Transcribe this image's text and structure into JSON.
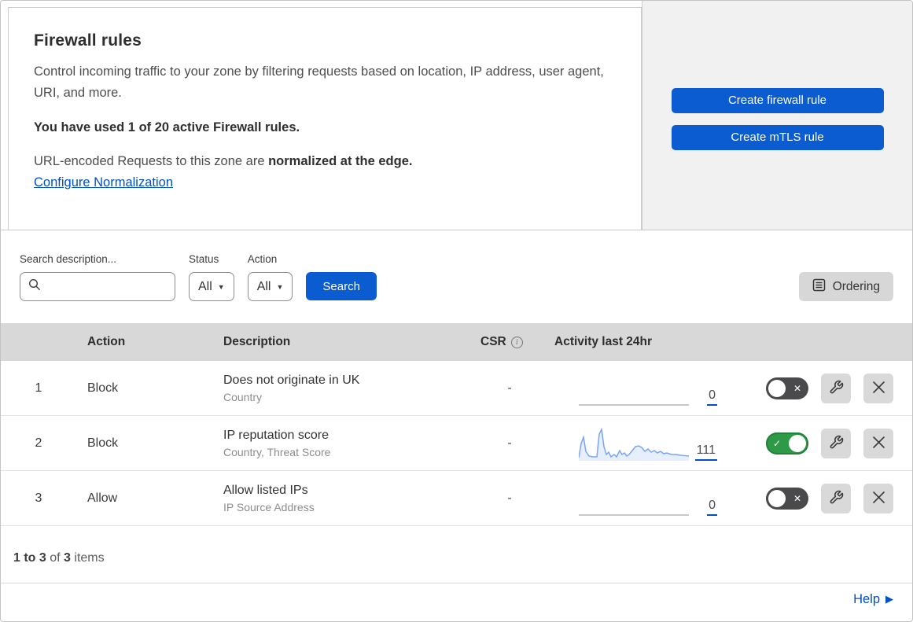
{
  "intro": {
    "title": "Firewall rules",
    "description": "Control incoming traffic to your zone by filtering requests based on location, IP address, user agent, URI, and more.",
    "usage": "You have used 1 of 20 active Firewall rules.",
    "normalization_prefix": "URL-encoded Requests to this zone are ",
    "normalization_bold": "normalized at the edge.",
    "normalization_link": "Configure Normalization"
  },
  "side_panel": {
    "create_firewall_label": "Create firewall rule",
    "create_mtls_label": "Create mTLS rule"
  },
  "toolbar": {
    "search_label": "Search description...",
    "status_label": "Status",
    "status_value": "All",
    "action_label": "Action",
    "action_value": "All",
    "search_button": "Search",
    "ordering_button": "Ordering"
  },
  "table": {
    "headers": {
      "action": "Action",
      "description": "Description",
      "csr": "CSR",
      "activity": "Activity last 24hr"
    },
    "rows": [
      {
        "index": "1",
        "action": "Block",
        "description": "Does not originate in UK",
        "fields": "Country",
        "csr": "-",
        "activity_count": "0",
        "enabled": false
      },
      {
        "index": "2",
        "action": "Block",
        "description": "IP reputation score",
        "fields": "Country, Threat Score",
        "csr": "-",
        "activity_count": "111",
        "enabled": true
      },
      {
        "index": "3",
        "action": "Allow",
        "description": "Allow listed IPs",
        "fields": "IP Source Address",
        "csr": "-",
        "activity_count": "0",
        "enabled": false
      }
    ]
  },
  "footer": {
    "range_text": "1 to 3",
    "of_text": " of ",
    "total_text": "3",
    "items_text": " items",
    "help_label": "Help"
  },
  "colors": {
    "accent_blue": "#0b5bd1",
    "link_blue": "#0051c3",
    "toggle_on_green": "#2e9a47",
    "toggle_off_gray": "#4a4a4d",
    "header_gray": "#d8d8d8",
    "panel_gray": "#f1f1f1",
    "sparkline_blue": "#7aa5f2"
  }
}
